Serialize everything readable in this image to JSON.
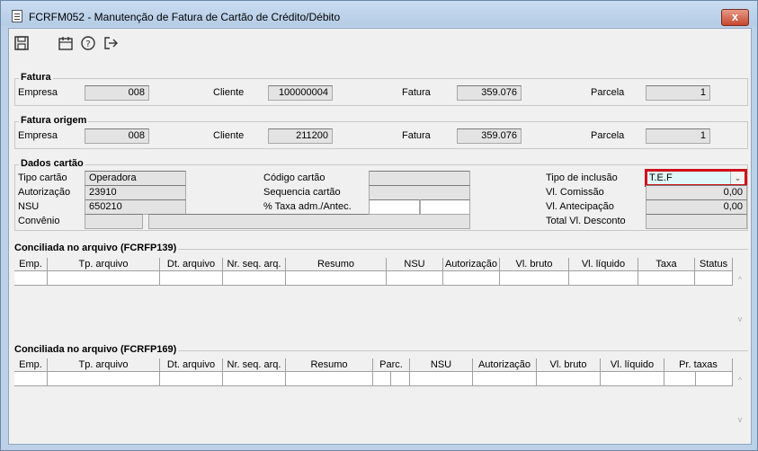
{
  "window": {
    "title": "FCRFM052 - Manutenção de Fatura de Cartão de Crédito/Débito",
    "close": "x"
  },
  "toolbar": {
    "save": "save-icon",
    "calendar": "calendar-icon",
    "help": "help-icon",
    "exit": "exit-icon"
  },
  "fatura": {
    "title": "Fatura",
    "empresa_label": "Empresa",
    "empresa": "008",
    "cliente_label": "Cliente",
    "cliente": "100000004",
    "fatura_label": "Fatura",
    "fatura": "359.076",
    "parcela_label": "Parcela",
    "parcela": "1"
  },
  "fatura_origem": {
    "title": "Fatura origem",
    "empresa_label": "Empresa",
    "empresa": "008",
    "cliente_label": "Cliente",
    "cliente": "211200",
    "fatura_label": "Fatura",
    "fatura": "359.076",
    "parcela_label": "Parcela",
    "parcela": "1"
  },
  "dados_cartao": {
    "title": "Dados cartão",
    "tipo_cartao_label": "Tipo cartão",
    "tipo_cartao": "Operadora",
    "autorizacao_label": "Autorização",
    "autorizacao": "23910",
    "nsu_label": "NSU",
    "nsu": "650210",
    "convenio_label": "Convênio",
    "convenio_a": "",
    "convenio_b": "",
    "codigo_cartao_label": "Código cartão",
    "codigo_cartao": "",
    "sequencia_cartao_label": "Sequencia cartão",
    "sequencia_cartao": "",
    "taxa_label": "% Taxa adm./Antec.",
    "taxa_a": "",
    "taxa_b": "",
    "tipo_inclusao_label": "Tipo de inclusão",
    "tipo_inclusao": "T.E.F",
    "vl_comissao_label": "Vl. Comissão",
    "vl_comissao": "0,00",
    "vl_antecipacao_label": "Vl. Antecipação",
    "vl_antecipacao": "0,00",
    "total_desconto_label": "Total Vl. Desconto",
    "total_desconto": ""
  },
  "grid139": {
    "title": "Conciliada no arquivo (FCRFP139)",
    "columns": [
      "Emp.",
      "Tp. arquivo",
      "Dt. arquivo",
      "Nr. seq. arq.",
      "Resumo",
      "NSU",
      "Autorização",
      "Vl. bruto",
      "Vl. líquido",
      "Taxa",
      "Status"
    ]
  },
  "grid169": {
    "title": "Conciliada no arquivo (FCRFP169)",
    "columns": [
      "Emp.",
      "Tp. arquivo",
      "Dt. arquivo",
      "Nr. seq. arq.",
      "Resumo",
      "Parc.",
      "NSU",
      "Autorização",
      "Vl. bruto",
      "Vl. líquido",
      "Pr. taxas"
    ]
  },
  "scroll": {
    "up": "^",
    "down": "v"
  }
}
